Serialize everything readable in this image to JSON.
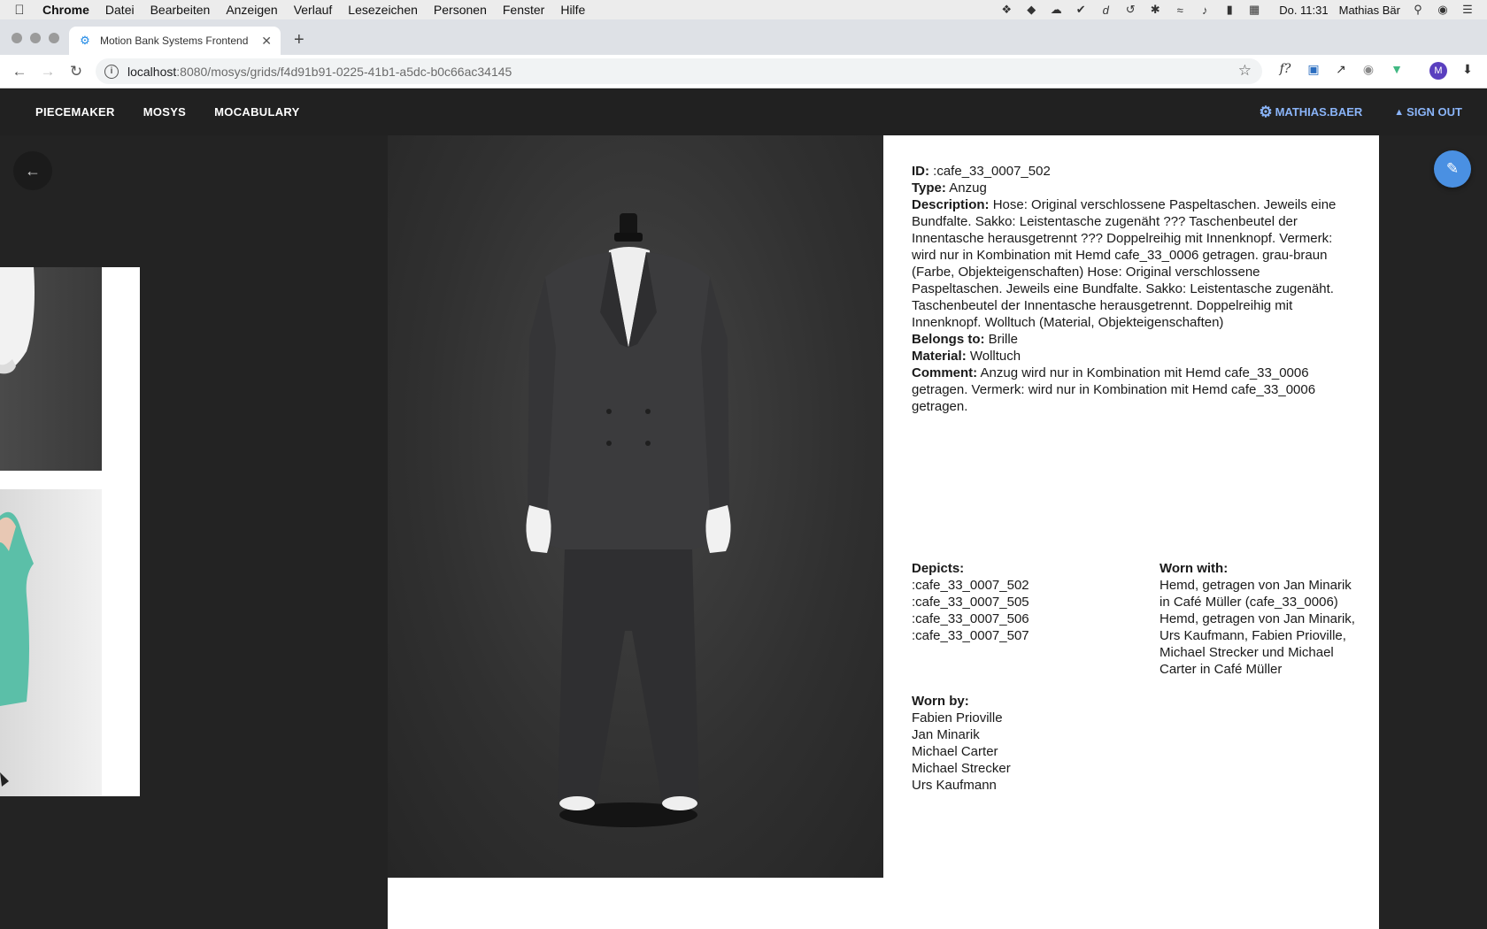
{
  "menubar": {
    "items": [
      "Chrome",
      "Datei",
      "Bearbeiten",
      "Anzeigen",
      "Verlauf",
      "Lesezeichen",
      "Personen",
      "Fenster",
      "Hilfe"
    ],
    "clock": "Do. 11:31",
    "user": "Mathias Bär",
    "status_icons": [
      "dropbox-icon",
      "evernote-icon",
      "creative-cloud-icon",
      "checkmark-icon",
      "dash-icon",
      "time-machine-icon",
      "bluetooth-icon",
      "wifi-icon",
      "volume-icon",
      "battery-icon",
      "calendar-icon",
      "spotlight-icon",
      "siri-icon",
      "notification-center-icon"
    ]
  },
  "browser": {
    "tab_title": "Motion Bank Systems Frontend",
    "url_host": "localhost",
    "url_path": ":8080/mosys/grids/f4d91b91-0225-41b1-a5dc-b0c66ac34145",
    "extensions": [
      "fontface-ninja-icon",
      "screenshot-extension-icon",
      "external-link-icon",
      "camera-icon",
      "vue-devtools-icon",
      "profile-avatar-icon",
      "download-icon"
    ],
    "profile_initial": "M"
  },
  "appnav": {
    "links": [
      "PIECEMAKER",
      "MOSYS",
      "MOCABULARY"
    ],
    "user_label": "MATHIAS.BAER",
    "signout_label": "SIGN OUT"
  },
  "details": {
    "id_label": "ID:",
    "id_value": ":cafe_33_0007_502",
    "type_label": "Type:",
    "type_value": "Anzug",
    "description_label": "Description:",
    "description_value": "Hose: Original verschlossene Paspeltaschen. Jeweils eine Bundfalte. Sakko: Leistentasche zugenäht ??? Taschenbeutel der Innentasche herausgetrennt ??? Doppelreihig mit Innenknopf. Vermerk: wird nur in Kombination mit Hemd cafe_33_0006 getragen. grau-braun (Farbe, Objekteigenschaften) Hose: Original verschlossene Paspeltaschen. Jeweils eine Bundfalte. Sakko: Leistentasche zugenäht. Taschenbeutel der Innentasche herausgetrennt. Doppelreihig mit Innenknopf. Wolltuch (Material, Objekteigenschaften)",
    "belongs_label": "Belongs to:",
    "belongs_value": "Brille",
    "material_label": "Material:",
    "material_value": "Wolltuch",
    "comment_label": "Comment:",
    "comment_value": "Anzug wird nur in Kombination mit Hemd cafe_33_0006 getragen. Vermerk: wird nur in Kombination mit Hemd cafe_33_0006 getragen."
  },
  "depicts": {
    "label": "Depicts:",
    "items": [
      ":cafe_33_0007_502",
      ":cafe_33_0007_505",
      ":cafe_33_0007_506",
      ":cafe_33_0007_507"
    ]
  },
  "worn_with": {
    "label": "Worn with:",
    "items": [
      "Hemd, getragen von Jan Minarik in Café Müller (cafe_33_0006)",
      "Hemd, getragen von Jan Minarik, Urs Kaufmann, Fabien Prioville, Michael Strecker und Michael Carter in Café Müller"
    ]
  },
  "worn_by": {
    "label": "Worn by:",
    "items": [
      "Fabien Prioville",
      "Jan Minarik",
      "Michael Carter",
      "Michael Strecker",
      "Urs Kaufmann"
    ]
  },
  "colors": {
    "accent": "#4a90e2",
    "appbar": "#212121",
    "user_link": "#8ab4f8"
  }
}
